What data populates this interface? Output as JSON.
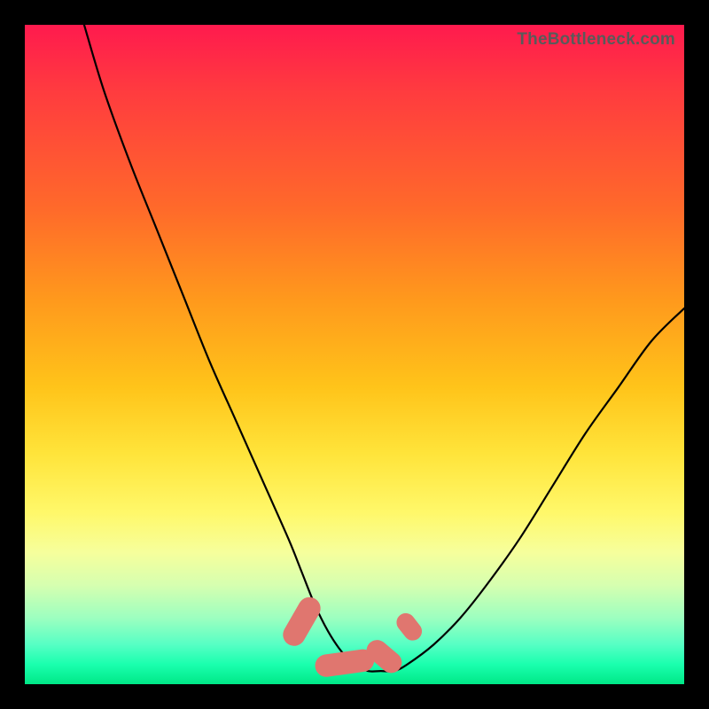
{
  "watermark": "TheBottleneck.com",
  "chart_data": {
    "type": "line",
    "title": "",
    "xlabel": "",
    "ylabel": "",
    "xlim": [
      0,
      100
    ],
    "ylim": [
      0,
      100
    ],
    "series": [
      {
        "name": "bottleneck-curve",
        "x": [
          9,
          12,
          16,
          20,
          24,
          28,
          32,
          36,
          40,
          42,
          44,
          46,
          48,
          50,
          52,
          54,
          56,
          58,
          62,
          66,
          70,
          75,
          80,
          85,
          90,
          95,
          100
        ],
        "values": [
          100,
          90,
          79,
          69,
          59,
          49,
          40,
          31,
          22,
          17,
          12,
          8,
          5,
          3,
          2,
          2,
          2,
          3,
          6,
          10,
          15,
          22,
          30,
          38,
          45,
          52,
          57
        ]
      }
    ],
    "markers": [
      {
        "name": "worm-segment-1",
        "shape": "capsule",
        "x": 42.0,
        "y": 9.5,
        "angle_deg": -60,
        "length": 8,
        "width": 3.4,
        "color": "#e0766f"
      },
      {
        "name": "worm-segment-2",
        "shape": "capsule",
        "x": 48.5,
        "y": 3.2,
        "angle_deg": -8,
        "length": 9,
        "width": 3.4,
        "color": "#e0766f"
      },
      {
        "name": "worm-segment-3",
        "shape": "capsule",
        "x": 54.5,
        "y": 4.2,
        "angle_deg": 40,
        "length": 6,
        "width": 3.2,
        "color": "#e0766f"
      },
      {
        "name": "worm-segment-4",
        "shape": "capsule",
        "x": 58.3,
        "y": 8.7,
        "angle_deg": 52,
        "length": 4.5,
        "width": 2.8,
        "color": "#e0766f"
      }
    ],
    "annotations": []
  }
}
